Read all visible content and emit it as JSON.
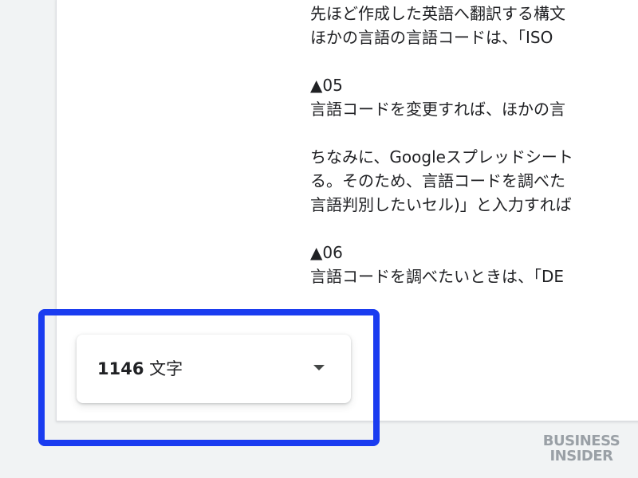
{
  "document": {
    "lines": [
      "先ほど作成した英語へ翻訳する構文",
      "ほかの言語の言語コードは、「ISO",
      "",
      "▲05",
      "言語コードを変更すれば、ほかの言",
      "",
      "ちなみに、Googleスプレッドシート",
      "る。そのため、言語コードを調べた",
      "言語判別したいセル)」と入力すれば",
      "",
      "▲06",
      "言語コードを調べたいときは、「DE"
    ]
  },
  "word_count": {
    "number": "1146",
    "unit": "文字"
  },
  "icons": {
    "dropdown": "chevron-down-icon"
  },
  "colors": {
    "highlight": "#1a3cf0",
    "page_background": "#f1f3f4"
  },
  "watermark": {
    "line1": "BUSINESS",
    "line2": "INSIDER"
  }
}
